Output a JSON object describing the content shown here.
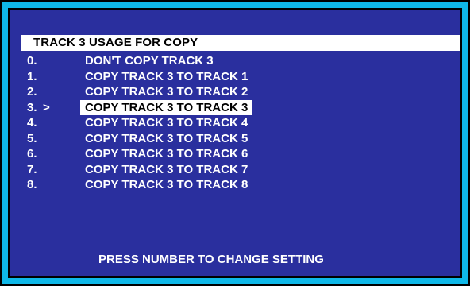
{
  "screen": {
    "title": "TRACK 3  USAGE FOR COPY",
    "footer": "PRESS NUMBER TO CHANGE SETTING",
    "cursor_symbol": ">",
    "options": [
      {
        "num": "0.",
        "label": "DON'T COPY TRACK 3"
      },
      {
        "num": "1.",
        "label": "COPY TRACK 3 TO TRACK 1"
      },
      {
        "num": "2.",
        "label": "COPY TRACK 3 TO TRACK 2"
      },
      {
        "num": "3.",
        "label": "COPY TRACK 3 TO TRACK 3"
      },
      {
        "num": "4.",
        "label": "COPY TRACK 3 TO TRACK 4"
      },
      {
        "num": "5.",
        "label": "COPY TRACK 3 TO TRACK 5"
      },
      {
        "num": "6.",
        "label": "COPY TRACK 3 TO TRACK 6"
      },
      {
        "num": "7.",
        "label": "COPY TRACK 3 TO TRACK 7"
      },
      {
        "num": "8.",
        "label": "COPY TRACK 3 TO TRACK 8"
      }
    ]
  },
  "colors": {
    "frame": "#0fb8e8",
    "screen_background": "#2a2f9e",
    "text": "#ffffff",
    "highlight": "#ffffff"
  }
}
